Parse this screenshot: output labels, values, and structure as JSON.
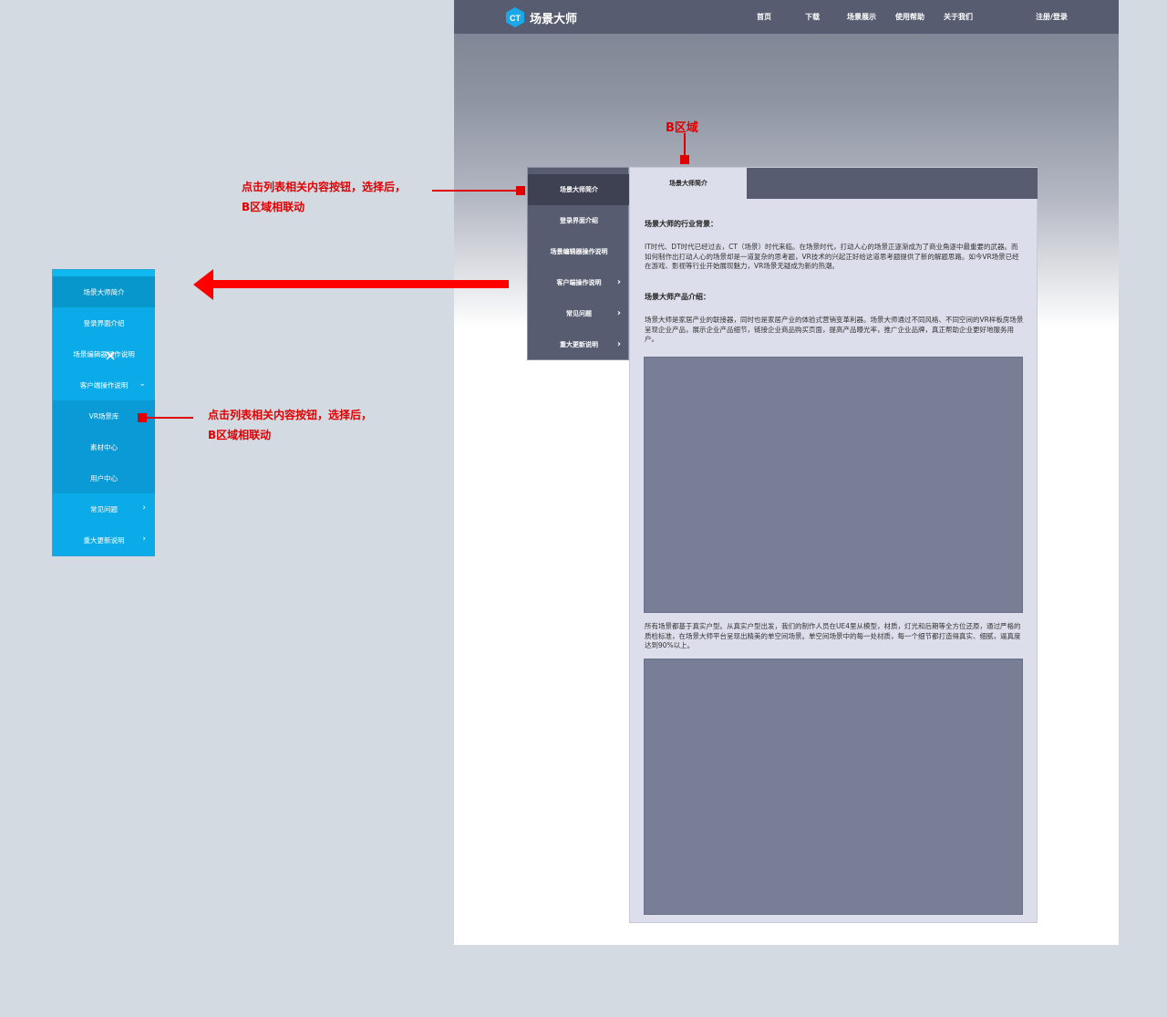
{
  "header": {
    "brand": "场景大师",
    "logo_text": "CT",
    "nav": [
      "首页",
      "下载",
      "场景展示",
      "使用帮助",
      "关于我们"
    ],
    "login": "注册/登录"
  },
  "b_area_label": "B区域",
  "sidemenu": {
    "items": [
      {
        "label": "场景大师简介",
        "arrow": false
      },
      {
        "label": "登录界面介绍",
        "arrow": false
      },
      {
        "label": "场景编辑器操作说明",
        "arrow": false
      },
      {
        "label": "客户端操作说明",
        "arrow": true
      },
      {
        "label": "常见问题",
        "arrow": true
      },
      {
        "label": "重大更新说明",
        "arrow": true
      }
    ]
  },
  "panel": {
    "tab": "场景大师简介",
    "heading1": "场景大师的行业背景：",
    "para1": "IT时代、DT时代已经过去，CT（场景）时代来临。在场景时代，打动人心的场景正逐渐成为了商业角逐中最重要的武器。而如何制作出打动人心的场景却是一道复杂的思考题，VR技术的兴起正好给这道思考题提供了新的解题思路。如今VR场景已经在游戏、影视等行业开始展现魅力，VR场景无疑成为新的热潮。",
    "heading2": "场景大师产品介绍：",
    "para2": "场景大师是家居产业的联接器，同时也是家居产业的体验式营销变革利器。场景大师通过不同风格、不同空间的VR样板房场景呈现企业产品，展示企业产品细节，链接企业商品购买页面，提高产品曝光率，推广企业品牌，真正帮助企业更好地服务用户。",
    "para3": "所有场景都基于真实户型。从真实户型出发，我们的制作人员在UE4里从模型，材质，灯光和后期等全方位还原，通过严格的质检标准，在场景大师平台呈现出精美的单空间场景。单空间场景中的每一处材质，每一个细节都打造得真实、细腻，逼真度达到90%以上。"
  },
  "annotations": {
    "note1_line1": "点击列表相关内容按钮，选择后，",
    "note1_line2": "B区域相联动",
    "note2_line1": "点击列表相关内容按钮，选择后，",
    "note2_line2": "B区域相联动"
  },
  "bluemenu": {
    "items": [
      {
        "label": "场景大师简介",
        "arrow": "none"
      },
      {
        "label": "登录界面介绍",
        "arrow": "none"
      },
      {
        "label": "场景编辑器操作说明",
        "arrow": "none"
      },
      {
        "label": "客户端操作说明",
        "arrow": "down"
      },
      {
        "label": "VR场景库",
        "arrow": "none"
      },
      {
        "label": "素材中心",
        "arrow": "none"
      },
      {
        "label": "用户中心",
        "arrow": "none"
      },
      {
        "label": "常见问题",
        "arrow": "right"
      },
      {
        "label": "重大更新说明",
        "arrow": "right"
      }
    ]
  },
  "colors": {
    "annotation": "#e00000",
    "nav_bg": "#575c70",
    "blue_menu": "#0aabe8"
  }
}
